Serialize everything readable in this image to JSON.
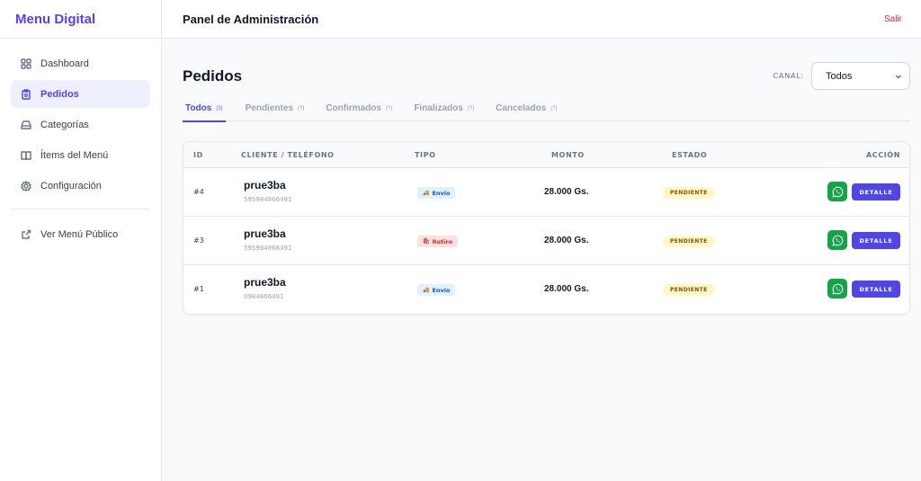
{
  "app": {
    "brand": "Menu Digital",
    "header_title": "Panel de Administración",
    "logout_label": "Salir"
  },
  "sidebar": {
    "items": [
      {
        "label": "Dashboard",
        "icon": "grid-icon"
      },
      {
        "label": "Pedidos",
        "icon": "clipboard-icon",
        "active": true
      },
      {
        "label": "Categorías",
        "icon": "tray-icon"
      },
      {
        "label": "Ítems del Menú",
        "icon": "book-icon"
      },
      {
        "label": "Configuración",
        "icon": "gear-icon"
      }
    ],
    "public_link": {
      "label": "Ver Menú Público",
      "icon": "external-link-icon"
    }
  },
  "main": {
    "title": "Pedidos",
    "channel": {
      "label": "CANAL:",
      "value": "Todos"
    },
    "tabs": [
      {
        "label": "Todos",
        "count": "(3)",
        "active": true
      },
      {
        "label": "Pendientes",
        "count": "(?)"
      },
      {
        "label": "Confirmados",
        "count": "(?)"
      },
      {
        "label": "Finalizados",
        "count": "(?)"
      },
      {
        "label": "Cancelados",
        "count": "(?)"
      }
    ],
    "table": {
      "headers": [
        "ID",
        "CLIENTE / TELÉFONO",
        "TIPO",
        "MONTO",
        "ESTADO",
        "ACCIÓN"
      ],
      "rows": [
        {
          "id": "#4",
          "name": "prue3ba",
          "phone": "595984866491",
          "type": "Envío",
          "type_kind": "envio",
          "amount": "28.000 Gs.",
          "status": "PENDIENTE",
          "action": "DETALLE"
        },
        {
          "id": "#3",
          "name": "prue3ba",
          "phone": "595984866491",
          "type": "Retiro",
          "type_kind": "retiro",
          "amount": "28.000 Gs.",
          "status": "PENDIENTE",
          "action": "DETALLE"
        },
        {
          "id": "#1",
          "name": "prue3ba",
          "phone": "0984866491",
          "type": "Envío",
          "type_kind": "envio",
          "amount": "28.000 Gs.",
          "status": "PENDIENTE",
          "action": "DETALLE"
        }
      ]
    }
  },
  "colors": {
    "accent": "#4f46e5",
    "brand": "#5b3df5",
    "logout": "#dc2626",
    "whatsapp": "#16a34a",
    "status_pending_bg": "#fef9c3"
  }
}
